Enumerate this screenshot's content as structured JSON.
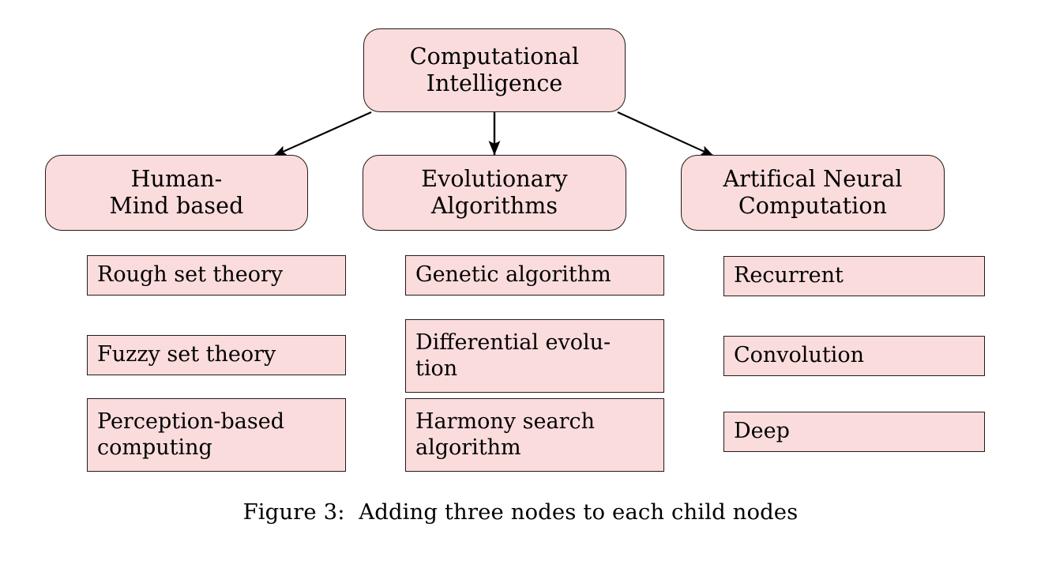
{
  "figure": {
    "caption": "Figure 3:  Adding three nodes to each child nodes",
    "colors": {
      "node_fill": "#fbdcdc",
      "node_border": "#241a1a",
      "background": "#ffffff",
      "arrow": "#000000"
    }
  },
  "root": {
    "line1": "Computational",
    "line2": "Intelligence"
  },
  "branches": [
    {
      "title_line1": "Human-",
      "title_line2": "Mind based",
      "leaves": [
        {
          "line1": "Rough set theory",
          "line2": ""
        },
        {
          "line1": "Fuzzy set theory",
          "line2": ""
        },
        {
          "line1": "Perception-based",
          "line2": "computing"
        }
      ]
    },
    {
      "title_line1": "Evolutionary",
      "title_line2": "Algorithms",
      "leaves": [
        {
          "line1": "Genetic algorithm",
          "line2": ""
        },
        {
          "line1": "Differential evolu-",
          "line2": "tion"
        },
        {
          "line1": "Harmony search",
          "line2": "algorithm"
        }
      ]
    },
    {
      "title_line1": "Artifical Neural",
      "title_line2": "Computation",
      "leaves": [
        {
          "line1": "Recurrent",
          "line2": ""
        },
        {
          "line1": "Convolution",
          "line2": ""
        },
        {
          "line1": "Deep",
          "line2": ""
        }
      ]
    }
  ]
}
